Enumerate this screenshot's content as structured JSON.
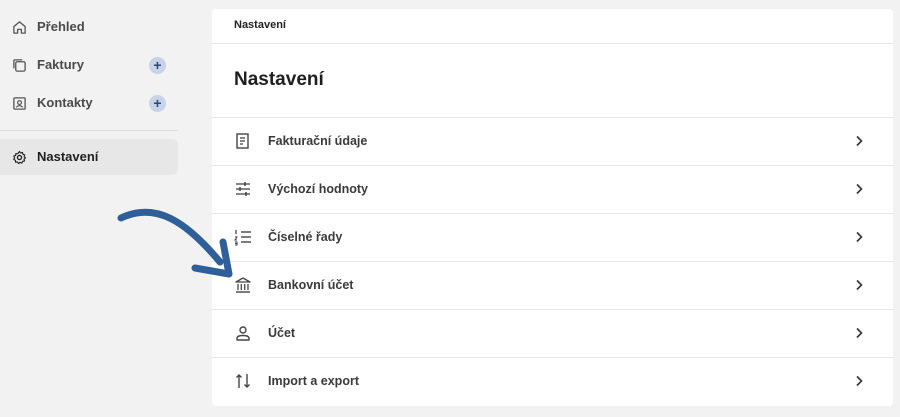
{
  "sidebar": {
    "items": [
      {
        "label": "Přehled",
        "icon": "home-icon"
      },
      {
        "label": "Faktury",
        "icon": "copy-icon",
        "add_label": "+"
      },
      {
        "label": "Kontakty",
        "icon": "contact-icon",
        "add_label": "+"
      },
      {
        "label": "Nastavení",
        "icon": "gear-icon",
        "active": true
      }
    ]
  },
  "main": {
    "breadcrumb": "Nastavení",
    "title": "Nastavení",
    "rows": [
      {
        "label": "Fakturační údaje",
        "icon": "receipt-icon"
      },
      {
        "label": "Výchozí hodnoty",
        "icon": "sliders-icon"
      },
      {
        "label": "Číselné řady",
        "icon": "numbered-list-icon"
      },
      {
        "label": "Bankovní účet",
        "icon": "bank-icon"
      },
      {
        "label": "Účet",
        "icon": "person-icon"
      },
      {
        "label": "Import a export",
        "icon": "arrows-updown-icon"
      }
    ]
  },
  "colors": {
    "accent_arrow": "#2f5f98",
    "plus_bg": "#c7d3e8",
    "active_bg": "#e7e7e7"
  }
}
